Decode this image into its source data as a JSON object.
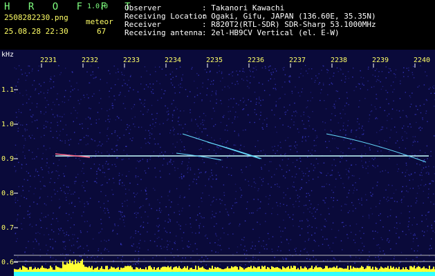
{
  "app": {
    "title": "H R O F F T",
    "version": "1.0.0"
  },
  "file": {
    "name": "2508282230.png",
    "datetime": "25.08.28 22:30"
  },
  "meteor": {
    "label": "meteor",
    "count": "67"
  },
  "info": {
    "rows": [
      {
        "key": "Observer",
        "value": ": Takanori Kawachi"
      },
      {
        "key": "Receiving Location",
        "value": ": Ogaki, Gifu, JAPAN (136.60E, 35.35N)"
      },
      {
        "key": "Receiver",
        "value": ": R820T2(RTL-SDR) SDR-Sharp 53.1000MHz"
      },
      {
        "key": "Receiving antenna",
        "value": ": 2el-HB9CV Vertical (el. E-W)"
      }
    ]
  },
  "spectrogram": {
    "unit_label": "kHz",
    "time_ticks": [
      "2231",
      "2232",
      "2233",
      "2234",
      "2235",
      "2236",
      "2237",
      "2238",
      "2239",
      "2240"
    ],
    "freq_ticks": [
      "1.1",
      "1.0",
      "0.9",
      "0.8",
      "0.7",
      "0.6"
    ],
    "colors": {
      "background": "#0a0a3a",
      "noise": "#3b3bd0",
      "carrier": "#c8ffff",
      "meteor": "#66ddff",
      "activity": "#ffff33",
      "baseline": "#33ffff"
    }
  }
}
